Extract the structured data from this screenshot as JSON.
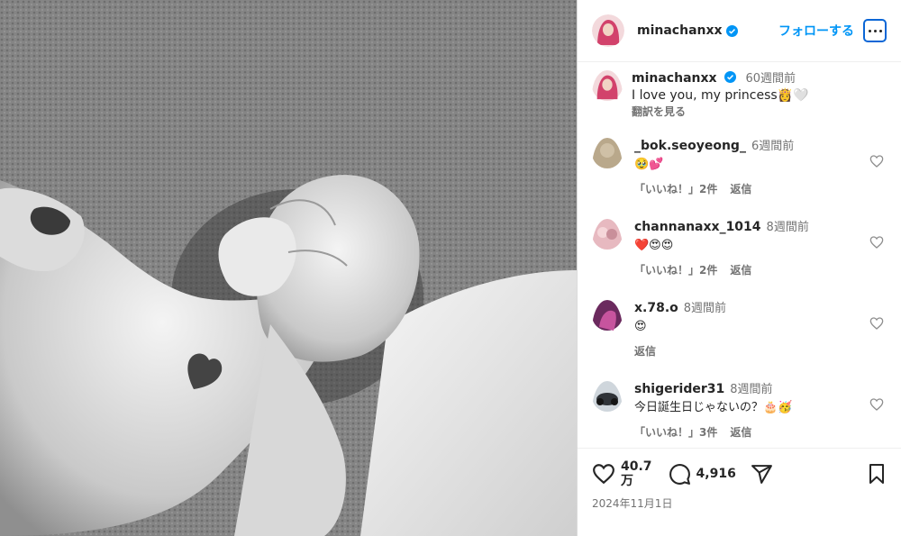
{
  "post": {
    "author": "minachanxx",
    "follow_label": "フォローする"
  },
  "caption": {
    "username": "minachanxx",
    "time": "60週間前",
    "text": "I love you, my princess👸🤍",
    "translate": "翻訳を見る"
  },
  "comments": [
    {
      "username": "_bok.seoyeong_",
      "time": "6週間前",
      "text": "🥹💕",
      "likes": "「いいね！」2件",
      "reply": "返信"
    },
    {
      "username": "channanaxx_1014",
      "time": "8週間前",
      "text": "❤️😍😍",
      "likes": "「いいね！」2件",
      "reply": "返信"
    },
    {
      "username": "x.78.o",
      "time": "8週間前",
      "text": "😍",
      "likes": "",
      "reply": "返信"
    },
    {
      "username": "shigerider31",
      "time": "8週間前",
      "text": "今日誕生日じゃないの？🎂🥳",
      "likes": "「いいね！」3件",
      "reply": "返信"
    }
  ],
  "stats": {
    "likes_line1": "40.7",
    "likes_line2": "万",
    "comments": "4,916",
    "date": "2024年11月1日"
  },
  "colors": {
    "accent": "#0095f6",
    "verified": "#0095f6",
    "muted": "#737373"
  }
}
